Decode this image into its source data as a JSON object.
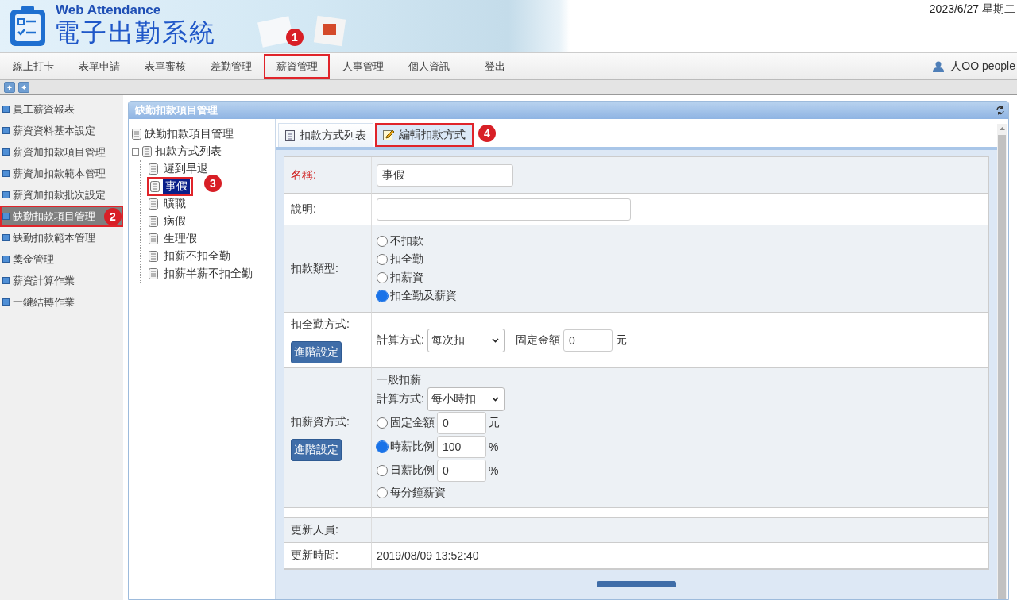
{
  "header": {
    "subtitle": "Web Attendance",
    "title": "電子出勤系統",
    "date": "2023/6/27 星期二"
  },
  "nav": {
    "items": [
      {
        "label": "線上打卡",
        "marked": false
      },
      {
        "label": "表單申請",
        "marked": false
      },
      {
        "label": "表單審核",
        "marked": false
      },
      {
        "label": "差勤管理",
        "marked": false
      },
      {
        "label": "薪資管理",
        "marked": true,
        "callout": "1"
      },
      {
        "label": "人事管理",
        "marked": false
      },
      {
        "label": "個人資訊",
        "marked": false
      },
      {
        "label": "登出",
        "marked": false
      }
    ],
    "user": "人OO people"
  },
  "sidebar": {
    "items": [
      {
        "label": "員工薪資報表",
        "selected": false,
        "marked": false
      },
      {
        "label": "薪資資料基本設定",
        "selected": false,
        "marked": false
      },
      {
        "label": "薪資加扣款項目管理",
        "selected": false,
        "marked": false
      },
      {
        "label": "薪資加扣款範本管理",
        "selected": false,
        "marked": false
      },
      {
        "label": "薪資加扣款批次設定",
        "selected": false,
        "marked": false
      },
      {
        "label": "缺勤扣款項目管理",
        "selected": true,
        "marked": true,
        "callout": "2"
      },
      {
        "label": "缺勤扣款範本管理",
        "selected": false,
        "marked": false
      },
      {
        "label": "獎金管理",
        "selected": false,
        "marked": false
      },
      {
        "label": "薪資計算作業",
        "selected": false,
        "marked": false
      },
      {
        "label": "一鍵結轉作業",
        "selected": false,
        "marked": false
      }
    ]
  },
  "panel": {
    "title": "缺勤扣款項目管理",
    "tree": {
      "label": "缺勤扣款項目管理",
      "children": [
        {
          "label": "扣款方式列表",
          "expanded": true,
          "children": [
            {
              "label": "遲到早退",
              "selected": false,
              "marked": false
            },
            {
              "label": "事假",
              "selected": true,
              "marked": true,
              "callout": "3"
            },
            {
              "label": "曠職",
              "selected": false,
              "marked": false
            },
            {
              "label": "病假",
              "selected": false,
              "marked": false
            },
            {
              "label": "生理假",
              "selected": false,
              "marked": false
            },
            {
              "label": "扣薪不扣全勤",
              "selected": false,
              "marked": false
            },
            {
              "label": "扣薪半薪不扣全勤",
              "selected": false,
              "marked": false
            }
          ]
        }
      ]
    },
    "tabs": [
      {
        "label": "扣款方式列表",
        "selected": false,
        "marked": false
      },
      {
        "label": "編輯扣款方式",
        "selected": true,
        "marked": true,
        "callout": "4"
      }
    ],
    "form": {
      "name": {
        "label": "名稱:",
        "required": true,
        "value": "事假"
      },
      "description": {
        "label": "說明:",
        "required": false
      },
      "deduction_type": {
        "label": "扣款類型:",
        "options": [
          {
            "label": "不扣款",
            "selected": false
          },
          {
            "label": "扣全勤",
            "selected": false
          },
          {
            "label": "扣薪資",
            "selected": false
          },
          {
            "label": "扣全勤及薪資",
            "selected": true
          }
        ]
      },
      "attendance_bonus": {
        "label": "扣全勤方式:",
        "button": "進階設定",
        "calc_label": "計算方式:",
        "calc_value": "每次扣",
        "amount_label": "固定金額",
        "amount_value": "0",
        "unit": "元"
      },
      "salary": {
        "label": "扣薪資方式:",
        "button": "進階設定",
        "heading": "一般扣薪",
        "calc_label": "計算方式:",
        "calc_value": "每小時扣",
        "options": [
          {
            "label": "固定金額",
            "selected": false,
            "value": "0",
            "unit": "元"
          },
          {
            "label": "時薪比例",
            "selected": true,
            "value": "100",
            "unit": "%"
          },
          {
            "label": "日薪比例",
            "selected": false,
            "value": "0",
            "unit": "%"
          },
          {
            "label": "每分鐘薪資",
            "selected": false
          }
        ]
      },
      "updated_by": {
        "label": "更新人員:"
      },
      "updated_at": {
        "label": "更新時間:",
        "value": "2019/08/09 13:52:40"
      }
    }
  }
}
